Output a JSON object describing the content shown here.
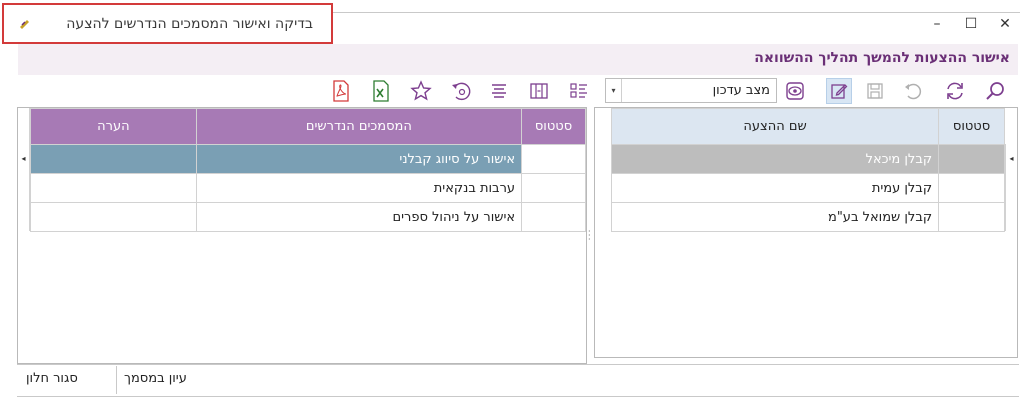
{
  "window": {
    "title": "בדיקה ואישור המסמכים הנדרשים להצעה",
    "minimize": "–",
    "maximize": "☐",
    "close": "✕"
  },
  "subheader": {
    "title": "אישור ההצעות להמשך תהליך ההשוואה"
  },
  "toolbar": {
    "state_value": "מצב עדכון"
  },
  "proposals_grid": {
    "columns": [
      "סטטוס",
      "שם ההצעה"
    ],
    "rows": [
      {
        "status": "",
        "name": "קבלן מיכאל"
      },
      {
        "status": "",
        "name": "קבלן עמית"
      },
      {
        "status": "",
        "name": "קבלן שמואל בע\"מ"
      }
    ]
  },
  "documents_grid": {
    "columns": [
      "סטטוס",
      "המסמכים הנדרשים",
      "הערה"
    ],
    "rows": [
      {
        "status": "",
        "document": "אישור על סיווג קבלני",
        "note": ""
      },
      {
        "status": "",
        "document": "ערבות בנקאית",
        "note": ""
      },
      {
        "status": "",
        "document": "אישור על ניהול ספרים",
        "note": ""
      }
    ]
  },
  "footer": {
    "view_document": "עיון במסמך",
    "close_window": "סגור חלון"
  },
  "colors": {
    "title_border": "#d33a3a",
    "subheader_text": "#6a2f76",
    "documents_header": "#a77ab5",
    "documents_selected_row": "#7a9fb4",
    "proposals_header": "#dce6f1",
    "proposals_selected_row": "#bdbdbd"
  }
}
